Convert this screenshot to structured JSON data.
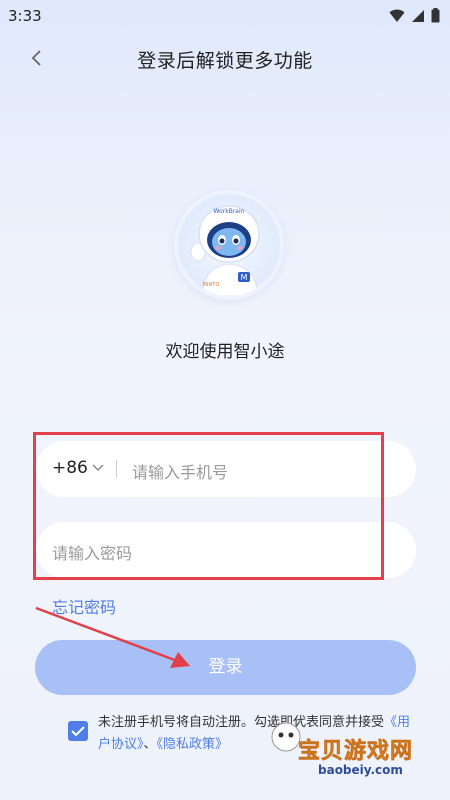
{
  "status_bar": {
    "time": "3:33"
  },
  "header": {
    "title": "登录后解锁更多功能"
  },
  "welcome": "欢迎使用智小途",
  "mascot": {
    "helmet_text": "WorkBrain",
    "badge_text": "M",
    "brand_text": "MINTO"
  },
  "phone": {
    "country_code": "+86",
    "placeholder": "请输入手机号"
  },
  "password": {
    "placeholder": "请输入密码"
  },
  "forgot_password": "忘记密码",
  "login_button": "登录",
  "agreement": {
    "checked": true,
    "text_prefix": "未注册手机号将自动注册。勾选即代表同意并接受",
    "link_user": "《用户协议》",
    "sep": "、",
    "link_privacy": "《隐私政策》"
  },
  "watermark": {
    "title": "宝贝游戏网",
    "url": "baobeiy.com"
  },
  "colors": {
    "accent": "#4f7ee8",
    "button": "#a9c0f7",
    "highlight": "#e2414c"
  }
}
